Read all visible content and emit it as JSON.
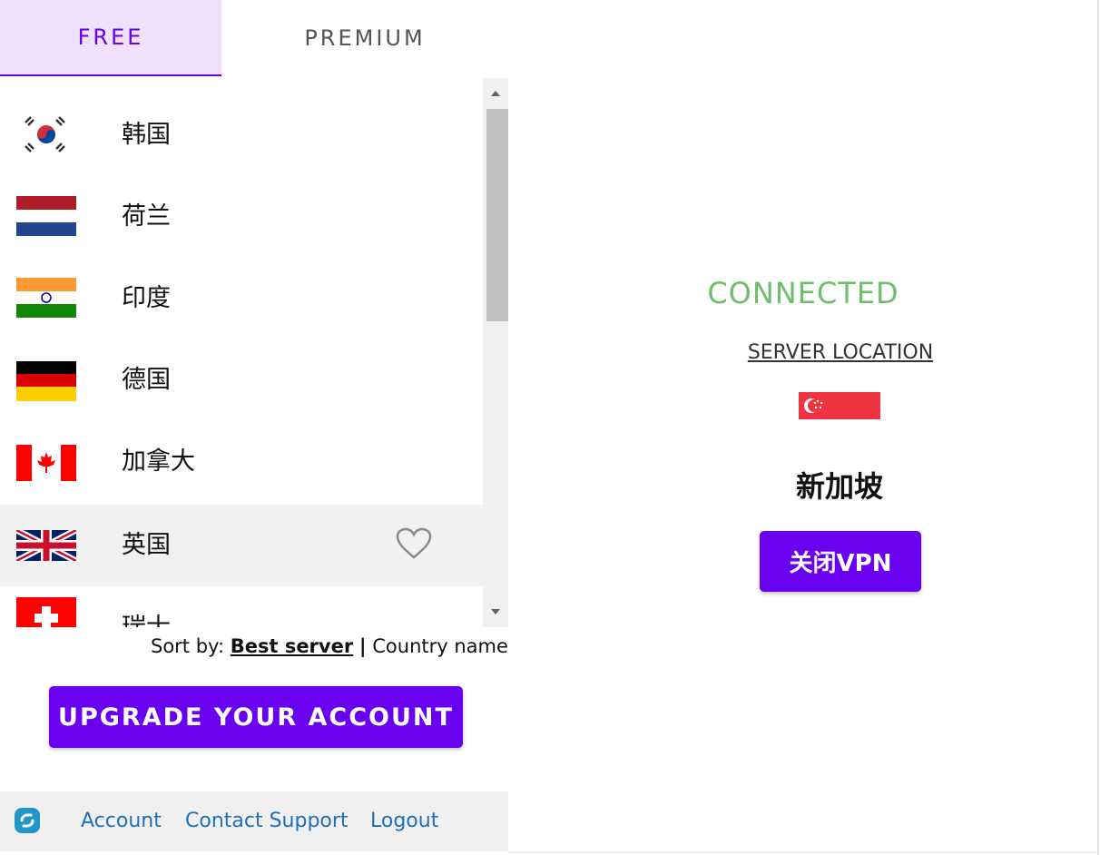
{
  "tabs": {
    "free": "FREE",
    "premium": "PREMIUM"
  },
  "countries": [
    {
      "name": "韩国",
      "flag": "south-korea-flag"
    },
    {
      "name": "荷兰",
      "flag": "netherlands-flag"
    },
    {
      "name": "印度",
      "flag": "india-flag"
    },
    {
      "name": "德国",
      "flag": "germany-flag"
    },
    {
      "name": "加拿大",
      "flag": "canada-flag"
    },
    {
      "name": "英国",
      "flag": "uk-flag",
      "selected": true,
      "favorite_icon": "heart-outline-icon"
    },
    {
      "name": "瑞士",
      "flag": "switzerland-flag"
    }
  ],
  "sort": {
    "prefix": "Sort by:",
    "active": "Best server",
    "separator": "|",
    "other": "Country name"
  },
  "upgrade_label": "UPGRADE YOUR ACCOUNT",
  "footer": {
    "logo_icon": "app-logo-icon",
    "links": [
      "Account",
      "Contact Support",
      "Logout"
    ]
  },
  "status": {
    "state": "CONNECTED",
    "server_location_label": "SERVER LOCATION",
    "server_flag": "singapore-flag",
    "server_name": "新加坡",
    "close_label": "关闭VPN"
  },
  "colors": {
    "accent": "#6a00f0",
    "tab_active_bg": "#efe1fc",
    "connected": "#6cc06c",
    "link": "#1f6fba"
  }
}
